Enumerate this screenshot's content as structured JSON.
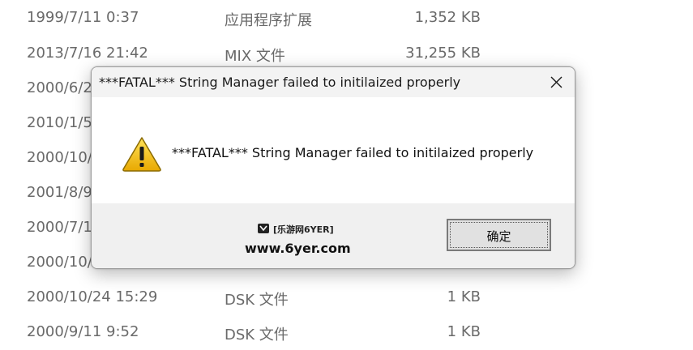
{
  "file_list": {
    "rows": [
      {
        "date": "1999/7/11 0:37",
        "type": "应用程序扩展",
        "size": "1,352 KB"
      },
      {
        "date": "2013/7/16 21:42",
        "type": "MIX 文件",
        "size": "31,255 KB"
      },
      {
        "date": "2000/6/2",
        "type": "",
        "size": ""
      },
      {
        "date": "2010/1/5",
        "type": "",
        "size": ""
      },
      {
        "date": "2000/10/",
        "type": "",
        "size": ""
      },
      {
        "date": "2001/8/9",
        "type": "",
        "size": ""
      },
      {
        "date": "2000/7/1",
        "type": "",
        "size": ""
      },
      {
        "date": "2000/10/",
        "type": "",
        "size": ""
      },
      {
        "date": "2000/10/24 15:29",
        "type": "DSK 文件",
        "size": "1 KB"
      },
      {
        "date": "2000/9/11 9:52",
        "type": "DSK 文件",
        "size": "1 KB"
      }
    ]
  },
  "dialog": {
    "title": "***FATAL*** String Manager failed to initilaized properly",
    "message": "***FATAL*** String Manager failed to initilaized properly",
    "icon": "warning-icon",
    "close_icon": "close-icon",
    "ok_label": "确定",
    "watermark": {
      "brand": "[乐游网6YER]",
      "url": "www.6yer.com"
    }
  },
  "colors": {
    "footer_bg": "#f0f0f0",
    "titlebar_bg": "#f3f3f3",
    "warning_yellow": "#f2c300",
    "button_bg": "#e1e1e1"
  }
}
